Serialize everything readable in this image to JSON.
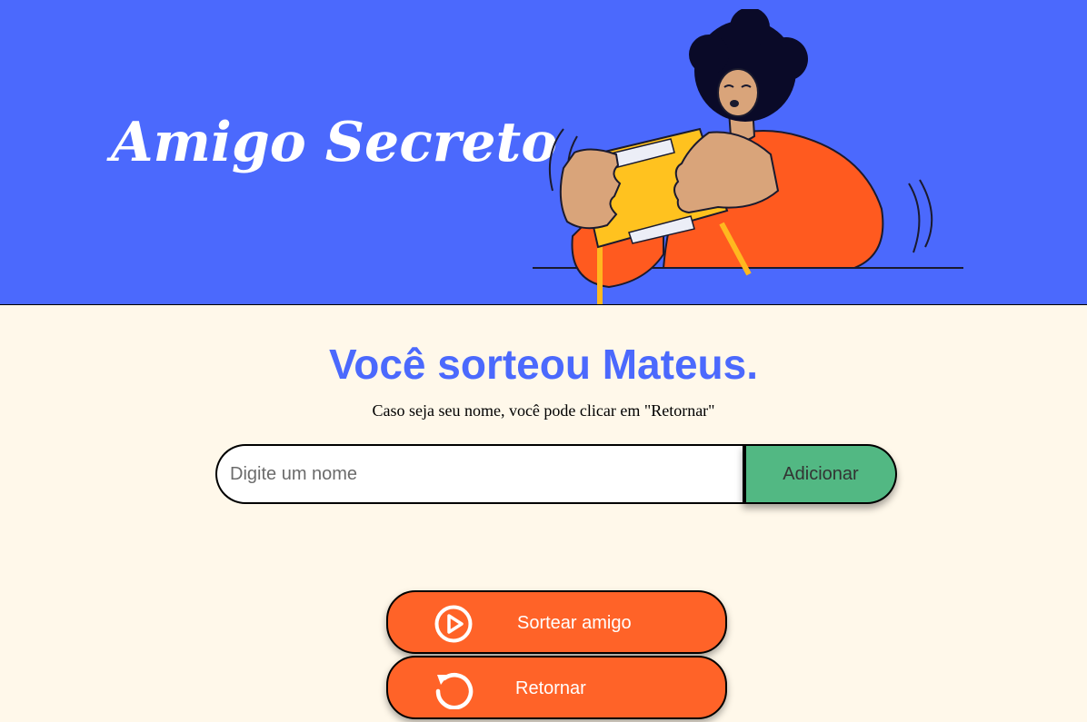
{
  "header": {
    "title": "Amigo Secreto",
    "illustration": "person-holding-yellow-device"
  },
  "main": {
    "result_text": "Você sorteou Mateus.",
    "hint_text": "Caso seja seu nome, você pode clicar em \"Retornar\""
  },
  "form": {
    "name_input": {
      "placeholder": "Digite um nome",
      "value": ""
    },
    "add_label": "Adicionar"
  },
  "actions": {
    "draw_label": "Sortear amigo",
    "draw_icon": "play-circle-icon",
    "return_label": "Retornar",
    "return_icon": "restart-icon"
  },
  "colors": {
    "header_bg": "#4B69FD",
    "page_bg": "#FFF8EA",
    "accent_orange": "#FF6328",
    "add_green": "#52B883",
    "result_blue": "#4B69FD"
  }
}
